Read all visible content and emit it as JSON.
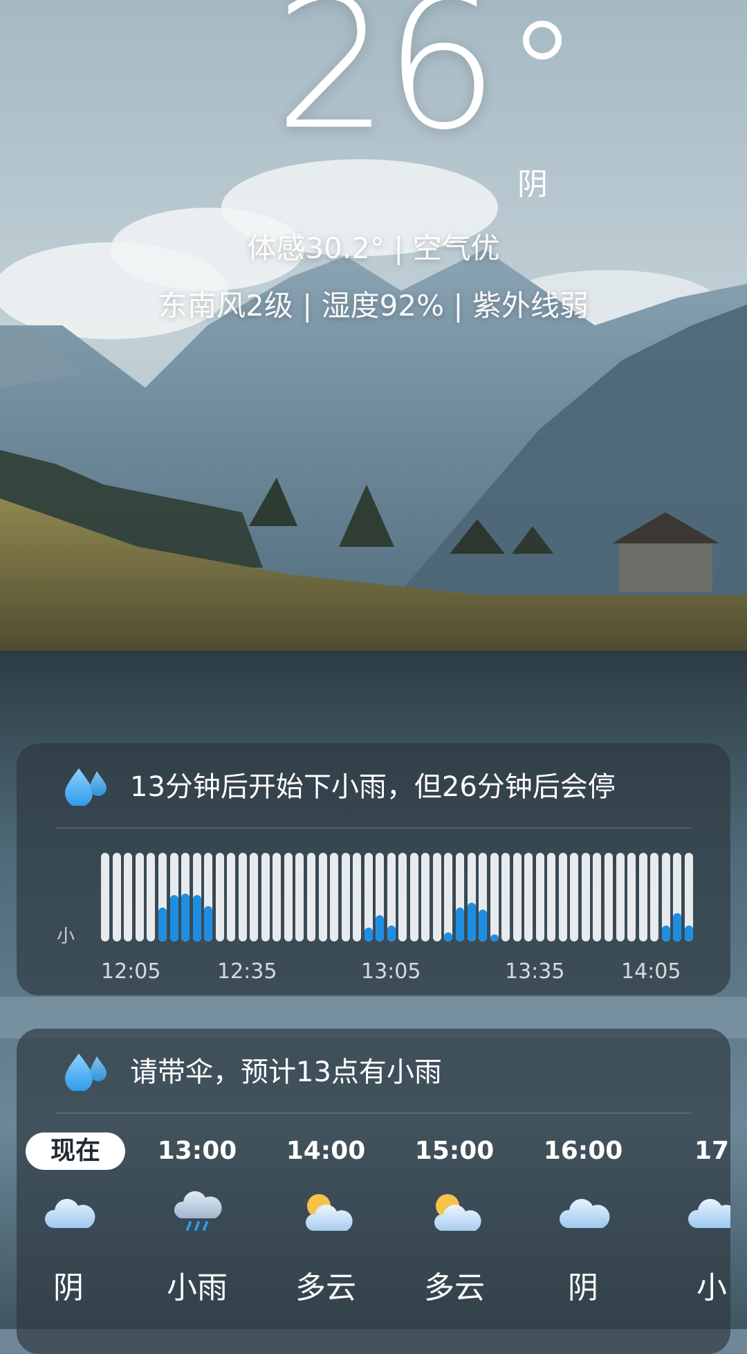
{
  "current": {
    "temperature": "26",
    "condition": "阴",
    "detail_line1": "体感30.2° | 空气优",
    "detail_line2": "东南风2级 | 湿度92% | 紫外线弱"
  },
  "precipitation": {
    "icon": "raindrops-icon",
    "summary": "13分钟后开始下小雨，但26分钟后会停",
    "scale_label": "小",
    "time_ticks": [
      "12:05",
      "12:35",
      "13:05",
      "13:35",
      "14:05"
    ],
    "intensity_levels": [
      0,
      0,
      0,
      0,
      0,
      0.38,
      0.52,
      0.54,
      0.52,
      0.4,
      0,
      0,
      0,
      0,
      0,
      0,
      0,
      0,
      0,
      0,
      0,
      0,
      0,
      0.16,
      0.3,
      0.18,
      0,
      0,
      0,
      0,
      0.1,
      0.38,
      0.44,
      0.36,
      0.08,
      0,
      0,
      0,
      0,
      0,
      0,
      0,
      0,
      0,
      0,
      0,
      0,
      0,
      0,
      0.18,
      0.32,
      0.18
    ],
    "colors": {
      "rain": "#1e8ee3",
      "empty": "#e8ebee"
    }
  },
  "hourly": {
    "icon": "raindrops-icon",
    "summary": "请带伞，预计13点有小雨",
    "items": [
      {
        "time": "现在",
        "icon": "cloud-icon",
        "condition": "阴",
        "selected": true
      },
      {
        "time": "13:00",
        "icon": "light-rain-icon",
        "condition": "小雨"
      },
      {
        "time": "14:00",
        "icon": "partly-cloudy-icon",
        "condition": "多云"
      },
      {
        "time": "15:00",
        "icon": "partly-cloudy-icon",
        "condition": "多云"
      },
      {
        "time": "16:00",
        "icon": "cloud-icon",
        "condition": "阴"
      },
      {
        "time": "17",
        "icon": "cloud-icon",
        "condition": "小"
      }
    ]
  }
}
